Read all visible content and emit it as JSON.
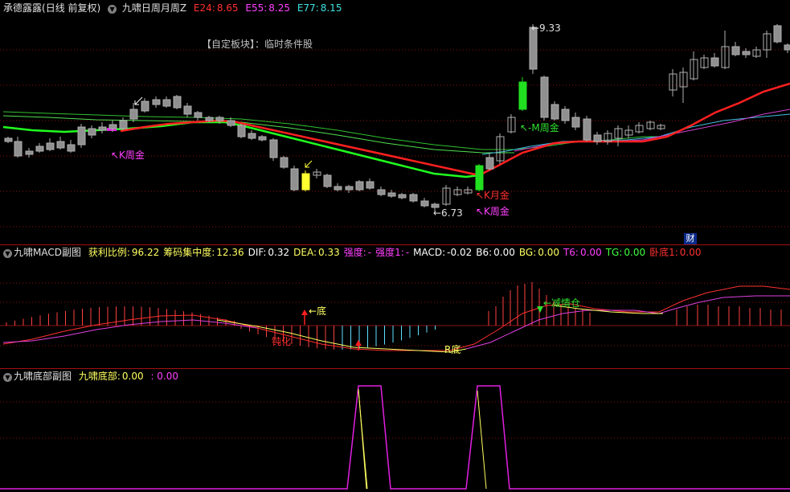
{
  "main_panel": {
    "stock_name": "承德露露",
    "period_info": "(日线 前复权)",
    "dropdown_icon": "chevron-down-icon",
    "indicator_name": "九啸日周月周Z",
    "e24": {
      "label": "E24:",
      "value": "8.65",
      "color": "#ff3030"
    },
    "e55": {
      "label": "E55:",
      "value": "8.25",
      "color": "#ff40ff"
    },
    "e77": {
      "label": "E77:",
      "value": "8.15",
      "color": "#40e0e0"
    },
    "block_text": "【自定板块】：临时条件股",
    "annotations": {
      "k_week_gold_1": "↖K周金",
      "k_month_gold": "↖K月金",
      "k_week_gold_2": "↖K周金",
      "m_week_gold": "↖-M周金",
      "low_price": "←6.73",
      "high_price": "←9.33"
    },
    "cai_badge": "财"
  },
  "macd_panel": {
    "title": "九啸MACD副图",
    "fields": [
      {
        "label": "获利比例:",
        "value": "96.22",
        "color": "#ffff60"
      },
      {
        "label": "筹码集中度:",
        "value": "12.36",
        "color": "#ffff60"
      },
      {
        "label": "DIF:",
        "value": "0.32",
        "color": "#ffffff"
      },
      {
        "label": "DEA:",
        "value": "0.33",
        "color": "#ffff60"
      },
      {
        "label": "强度:",
        "value": "-",
        "color": "#ff40ff"
      },
      {
        "label": "强度1:",
        "value": "-",
        "color": "#ff40ff"
      },
      {
        "label": "MACD:",
        "value": "-0.02",
        "color": "#ffffff"
      },
      {
        "label": "B6:",
        "value": "0.00",
        "color": "#ffffff"
      },
      {
        "label": "BG:",
        "value": "0.00",
        "color": "#ffff60"
      },
      {
        "label": "T6:",
        "value": "0.00",
        "color": "#ff40ff"
      },
      {
        "label": "TG:",
        "value": "0.00",
        "color": "#40ff40"
      },
      {
        "label": "卧底1:",
        "value": "0.00",
        "color": "#ff3030"
      }
    ],
    "annotations": {
      "bottom": "←底",
      "dun_hua": "钝化",
      "r_bottom": "R底",
      "reduce_position": "←减情仓"
    }
  },
  "bottom_panel": {
    "title": "九啸底部副图",
    "field_label": "九啸底部:",
    "field_value": "0.00",
    "field_value2": ": 0.00"
  }
}
